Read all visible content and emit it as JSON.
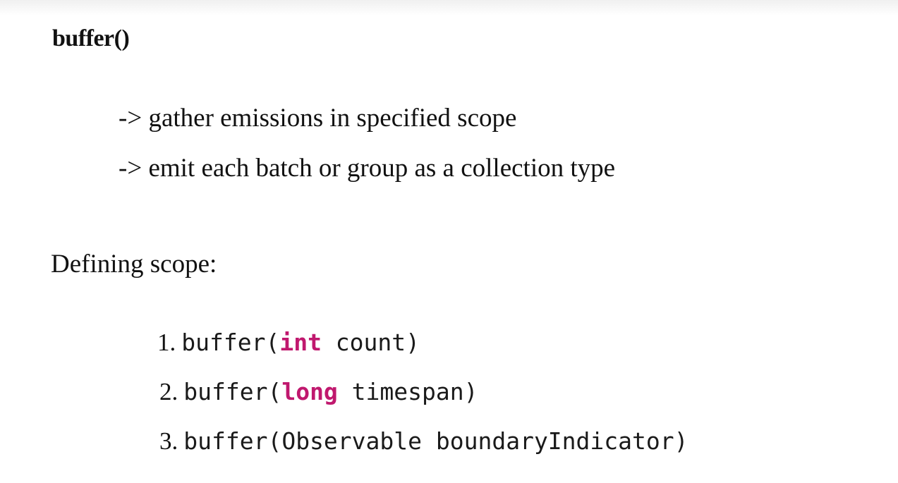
{
  "title": "buffer()",
  "bullets": [
    "-> gather emissions in specified scope",
    "-> emit each batch or group as a collection type"
  ],
  "scope_heading": "Defining scope:",
  "keyword_color": "#c0186e",
  "code_items": [
    {
      "number": "1.",
      "prefix": "buffer(",
      "keyword": "int",
      "suffix": " count)"
    },
    {
      "number": "2.",
      "prefix": "buffer(",
      "keyword": "long",
      "suffix": " timespan)"
    },
    {
      "number": "3.",
      "prefix": "buffer(Observable boundaryIndicator)",
      "keyword": "",
      "suffix": ""
    }
  ]
}
